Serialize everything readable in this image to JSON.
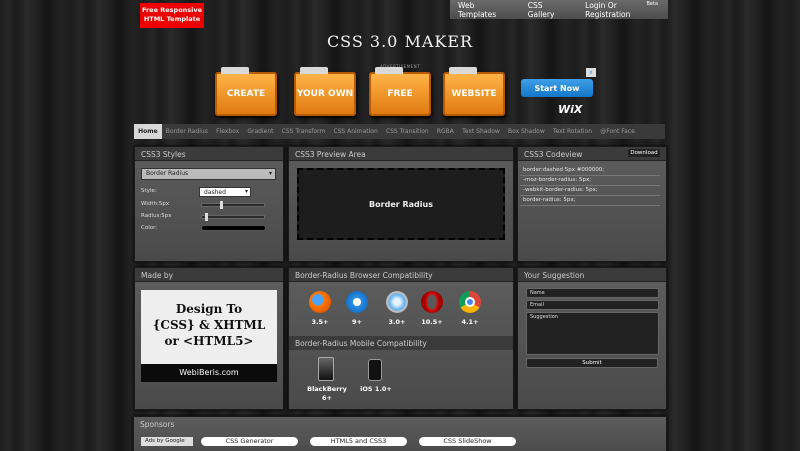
{
  "badge": {
    "line1": "Free Responsive",
    "line2": "HTML Template"
  },
  "topnav": {
    "items": [
      "Web Templates",
      "CSS Gallery",
      "Login Or Registration"
    ],
    "beta": "Beta"
  },
  "site_title": "CSS 3.0 MAKER",
  "ad": {
    "label": "ADVERTISEMENT",
    "folders": [
      "CREATE",
      "YOUR OWN",
      "FREE",
      "WEBSITE"
    ],
    "start_now": "Start Now",
    "close": "x",
    "brand": "WiX"
  },
  "tabs": [
    "Home",
    "Border Radius",
    "Flexbox",
    "Gradient",
    "CSS Transform",
    "CSS Animation",
    "CSS Transition",
    "RGBA",
    "Text Shadow",
    "Box Shadow",
    "Text Rotation",
    "@Font Face"
  ],
  "styles_panel": {
    "title": "CSS3 Styles",
    "property": "Border Radius",
    "style_label": "Style:",
    "style_value": "dashed",
    "width_label": "Width:5px",
    "width_level": 0.3,
    "radius_label": "Radius:5px",
    "radius_level": 0.05,
    "color_label": "Color:",
    "color_value": "#000000"
  },
  "preview_panel": {
    "title": "CSS3 Preview Area",
    "preview_text": "Border Radius"
  },
  "codeview_panel": {
    "title": "CSS3 Codeview",
    "download": "Download",
    "lines": [
      "border:dashed 5px #000000;",
      "-moz-border-radius: 5px;",
      "-webkit-border-radius: 5px;",
      "border-radius: 5px;"
    ]
  },
  "madeby_panel": {
    "title": "Made by",
    "card_lines": [
      "Design To",
      "{CSS} & XHTML",
      "or <HTML5>"
    ],
    "footer": "WebiBeris.com"
  },
  "compat_panel": {
    "title": "Border-Radius Browser Compatibility",
    "browsers": [
      {
        "icon": "firefox-icon",
        "version": "3.5+"
      },
      {
        "icon": "ie-icon",
        "version": "9+"
      },
      {
        "icon": "safari-icon",
        "version": "3.0+"
      },
      {
        "icon": "opera-icon",
        "version": "10.5+"
      },
      {
        "icon": "chrome-icon",
        "version": "4.1+"
      }
    ]
  },
  "mobile_panel": {
    "title": "Border-Radius Mobile Compatibility",
    "devices": [
      {
        "icon": "blackberry-icon",
        "name": "BlackBerry",
        "version": "6+"
      },
      {
        "icon": "iphone-icon",
        "name": "iOS 1.0+",
        "version": ""
      }
    ]
  },
  "suggestion_panel": {
    "title": "Your Suggestion",
    "name_placeholder": "Name",
    "email_placeholder": "Email",
    "suggestion_placeholder": "Suggestion",
    "submit": "Submit"
  },
  "sponsors": {
    "title": "Sponsors",
    "ads_by": "Ads by Google",
    "links": [
      "CSS Generator",
      "HTML5 and CSS3",
      "CSS SlideShow"
    ]
  }
}
